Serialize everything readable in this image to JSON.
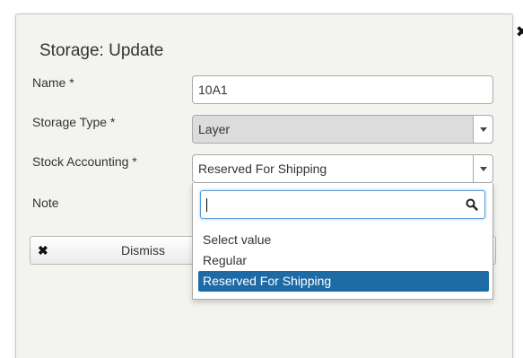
{
  "dialog": {
    "title": "Storage: Update",
    "close_label": "✖"
  },
  "form": {
    "name": {
      "label": "Name *",
      "value": "10A1"
    },
    "storage_type": {
      "label": "Storage Type *",
      "value": "Layer"
    },
    "stock_accounting": {
      "label": "Stock Accounting *",
      "value": "Reserved For Shipping"
    },
    "note": {
      "label": "Note"
    }
  },
  "dismiss": {
    "label": "Dismiss",
    "icon": "✖"
  },
  "dropdown": {
    "search_value": "",
    "options": [
      "Select value",
      "Regular",
      "Reserved For Shipping"
    ],
    "selected_index": 2
  },
  "colors": {
    "selected_option_bg": "#1e6aa5",
    "dialog_bg": "#f3f3ef",
    "focus_border": "#5b9bd5"
  }
}
